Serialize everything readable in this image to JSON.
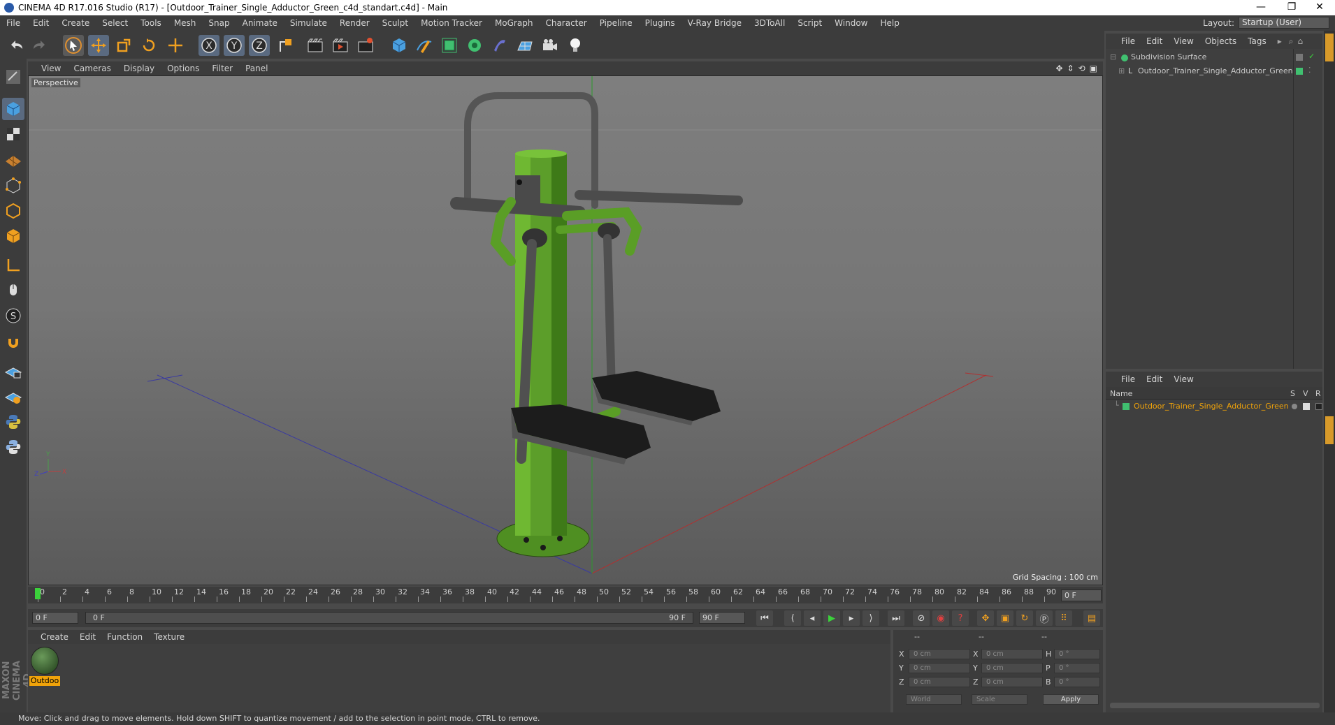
{
  "window": {
    "title": "CINEMA 4D R17.016 Studio (R17) - [Outdoor_Trainer_Single_Adductor_Green_c4d_standart.c4d] - Main",
    "minimize": "—",
    "restore": "❐",
    "close": "✕"
  },
  "menubar": {
    "items": [
      "File",
      "Edit",
      "Create",
      "Select",
      "Tools",
      "Mesh",
      "Snap",
      "Animate",
      "Simulate",
      "Render",
      "Sculpt",
      "Motion Tracker",
      "MoGraph",
      "Character",
      "Pipeline",
      "Plugins",
      "V-Ray Bridge",
      "3DToAll",
      "Script",
      "Window",
      "Help"
    ],
    "layout_label": "Layout:",
    "layout_value": "Startup (User)"
  },
  "viewport": {
    "menu": [
      "View",
      "Cameras",
      "Display",
      "Options",
      "Filter",
      "Panel"
    ],
    "camera_label": "Perspective",
    "grid_spacing": "Grid Spacing : 100 cm"
  },
  "timeline": {
    "ticks": [
      "0",
      "2",
      "4",
      "6",
      "8",
      "10",
      "12",
      "14",
      "16",
      "18",
      "20",
      "22",
      "24",
      "26",
      "28",
      "30",
      "32",
      "34",
      "36",
      "38",
      "40",
      "42",
      "44",
      "46",
      "48",
      "50",
      "52",
      "54",
      "56",
      "58",
      "60",
      "62",
      "64",
      "66",
      "68",
      "70",
      "72",
      "74",
      "76",
      "78",
      "80",
      "82",
      "84",
      "86",
      "88",
      "90"
    ],
    "current_frame": "0 F",
    "start_field": "0 F",
    "range_start": "0 F",
    "range_end": "90 F",
    "end_field": "90 F"
  },
  "material_manager": {
    "menu": [
      "Create",
      "Edit",
      "Function",
      "Texture"
    ],
    "material_name": "Outdoo"
  },
  "coordinates": {
    "header_dashes": [
      "--",
      "--",
      "--"
    ],
    "rows": [
      {
        "a": "X",
        "av": "0 cm",
        "b": "X",
        "bv": "0 cm",
        "c": "H",
        "cv": "0 °"
      },
      {
        "a": "Y",
        "av": "0 cm",
        "b": "Y",
        "bv": "0 cm",
        "c": "P",
        "cv": "0 °"
      },
      {
        "a": "Z",
        "av": "0 cm",
        "b": "Z",
        "bv": "0 cm",
        "c": "B",
        "cv": "0 °"
      }
    ],
    "mode": "World",
    "transform": "Scale",
    "apply": "Apply"
  },
  "object_manager": {
    "menu": [
      "File",
      "Edit",
      "View",
      "Objects",
      "Tags"
    ],
    "objects": [
      {
        "name": "Subdivision Surface"
      },
      {
        "name": "Outdoor_Trainer_Single_Adductor_Green"
      }
    ]
  },
  "attribute_manager": {
    "menu": [
      "File",
      "Edit",
      "View"
    ],
    "columns": {
      "name": "Name",
      "s": "S",
      "v": "V",
      "r": "R"
    },
    "row": "Outdoor_Trainer_Single_Adductor_Green"
  },
  "maxon_logo": "MAXON CINEMA 4D",
  "status": "Move: Click and drag to move elements. Hold down SHIFT to quantize movement / add to the selection in point mode, CTRL to remove.",
  "colors": {
    "accent": "#e8a33c",
    "selection": "#f0a30a",
    "green": "#5fa830",
    "play": "#3bd23b"
  }
}
